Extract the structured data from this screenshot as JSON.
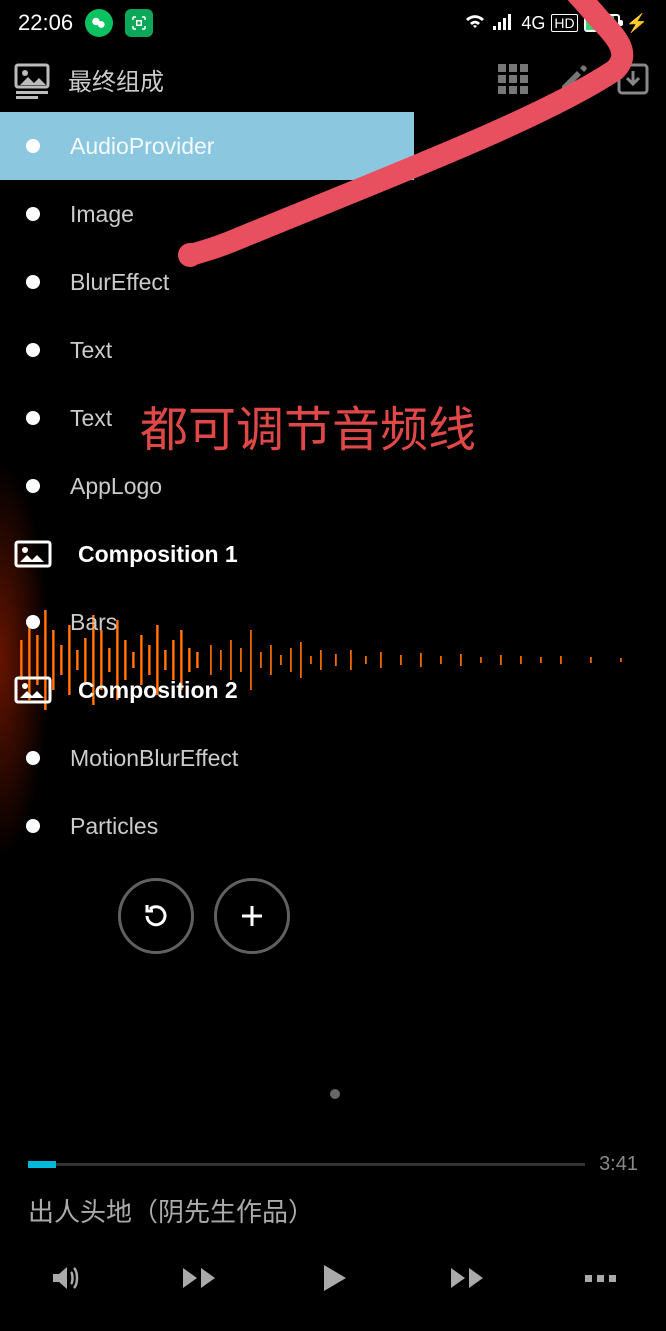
{
  "status": {
    "time": "22:06",
    "network": "4G",
    "hd": "HD"
  },
  "header": {
    "title": "最终组成"
  },
  "layers": [
    {
      "label": "AudioProvider",
      "selected": true,
      "type": "dot"
    },
    {
      "label": "Image",
      "selected": false,
      "type": "dot"
    },
    {
      "label": "BlurEffect",
      "selected": false,
      "type": "dot"
    },
    {
      "label": "Text",
      "selected": false,
      "type": "dot"
    },
    {
      "label": "Text",
      "selected": false,
      "type": "dot"
    },
    {
      "label": "AppLogo",
      "selected": false,
      "type": "dot"
    },
    {
      "label": "Composition 1",
      "selected": false,
      "type": "comp",
      "bold": true
    },
    {
      "label": "Bars",
      "selected": false,
      "type": "dot"
    },
    {
      "label": "Composition 2",
      "selected": false,
      "type": "comp",
      "bold": true
    },
    {
      "label": "MotionBlurEffect",
      "selected": false,
      "type": "dot"
    },
    {
      "label": "Particles",
      "selected": false,
      "type": "dot"
    }
  ],
  "annotation": {
    "text": "都可调节音频线"
  },
  "player": {
    "duration": "3:41",
    "track": "出人头地（阴先生作品）"
  }
}
